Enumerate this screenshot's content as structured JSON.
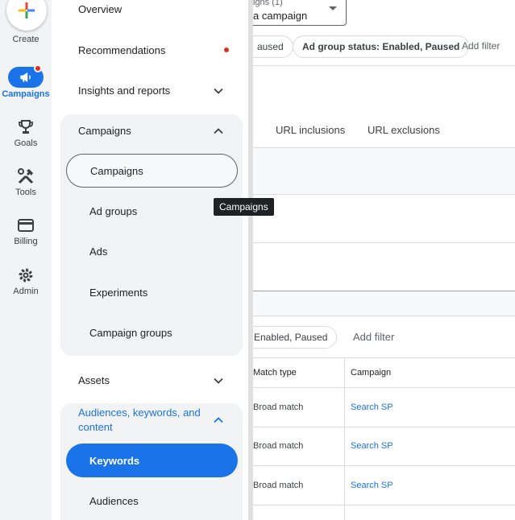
{
  "rail": {
    "create_label": "Create",
    "items": [
      {
        "label": "Campaigns",
        "icon": "megaphone-icon"
      },
      {
        "label": "Goals",
        "icon": "trophy-icon"
      },
      {
        "label": "Tools",
        "icon": "tools-icon"
      },
      {
        "label": "Billing",
        "icon": "credit-card-icon"
      },
      {
        "label": "Admin",
        "icon": "gear-icon"
      }
    ]
  },
  "nav": {
    "overview": "Overview",
    "recommendations": "Recommendations",
    "insights": "Insights and reports",
    "campaigns_group": {
      "title": "Campaigns",
      "items": [
        "Campaigns",
        "Ad groups",
        "Ads",
        "Experiments",
        "Campaign groups"
      ]
    },
    "assets": "Assets",
    "audiences_group": {
      "title": "Audiences, keywords, and content",
      "items": [
        "Keywords",
        "Audiences"
      ]
    }
  },
  "tooltip": "Campaigns",
  "content": {
    "dropdown_top": "igns (1)",
    "dropdown_value": "a campaign",
    "chip_paused": "aused",
    "chip_ad_group_status": "Ad group status: Enabled, Paused",
    "add_filter_top": "Add filter",
    "tab_url_inclusions": "URL inclusions",
    "tab_url_exclusions": "URL exclusions",
    "chip_enabled_paused": "Enabled, Paused",
    "add_filter_bottom": "Add filter",
    "table": {
      "headers": [
        "Match type",
        "Campaign"
      ],
      "rows": [
        [
          "Broad match",
          "Search SP"
        ],
        [
          "Broad match",
          "Search SP"
        ],
        [
          "Broad match",
          "Search SP"
        ]
      ]
    }
  },
  "colors": {
    "accent": "#1a73e8",
    "alert": "#d93025"
  }
}
